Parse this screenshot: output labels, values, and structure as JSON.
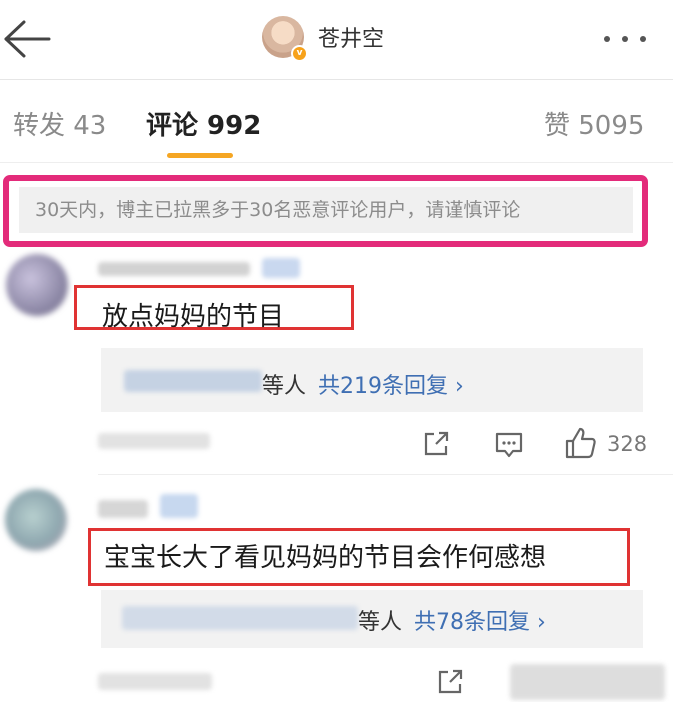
{
  "header": {
    "back_icon": "arrow-left-icon",
    "profile_name": "苍井空",
    "verified_badge": "v",
    "more_icon": "more-dots-icon"
  },
  "tabs": {
    "repost": "转发 43",
    "comment": "评论 992",
    "like": "赞 5095",
    "active": "comment",
    "accent_color": "#f5a623"
  },
  "notice": {
    "text": "30天内，博主已拉黑多于30名恶意评论用户，请谨慎评论",
    "highlight_color": "#e32b7a"
  },
  "comments": [
    {
      "text": "放点妈妈的节目",
      "reply_suffix": "等人",
      "reply_count": "共219条回复 ›",
      "like_count": "328"
    },
    {
      "text": "宝宝长大了看见妈妈的节目会作何感想",
      "reply_suffix": "等人",
      "reply_count": "共78条回复 ›"
    }
  ],
  "colors": {
    "annotation_red": "#e03333",
    "reply_link": "#3f6fb3"
  }
}
